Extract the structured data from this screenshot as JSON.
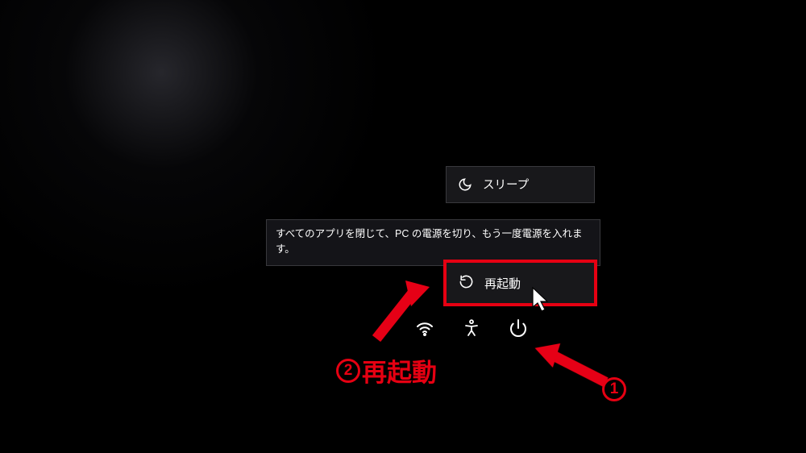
{
  "powerMenu": {
    "sleep": {
      "label": "スリープ"
    },
    "restart": {
      "label": "再起動"
    }
  },
  "tooltip": {
    "text": "すべてのアプリを閉じて、PC の電源を切り、もう一度電源を入れます。"
  },
  "annotations": {
    "step1": {
      "number": "1"
    },
    "step2": {
      "number": "2",
      "label": "再起動"
    }
  },
  "colors": {
    "annotation": "#e60012"
  }
}
